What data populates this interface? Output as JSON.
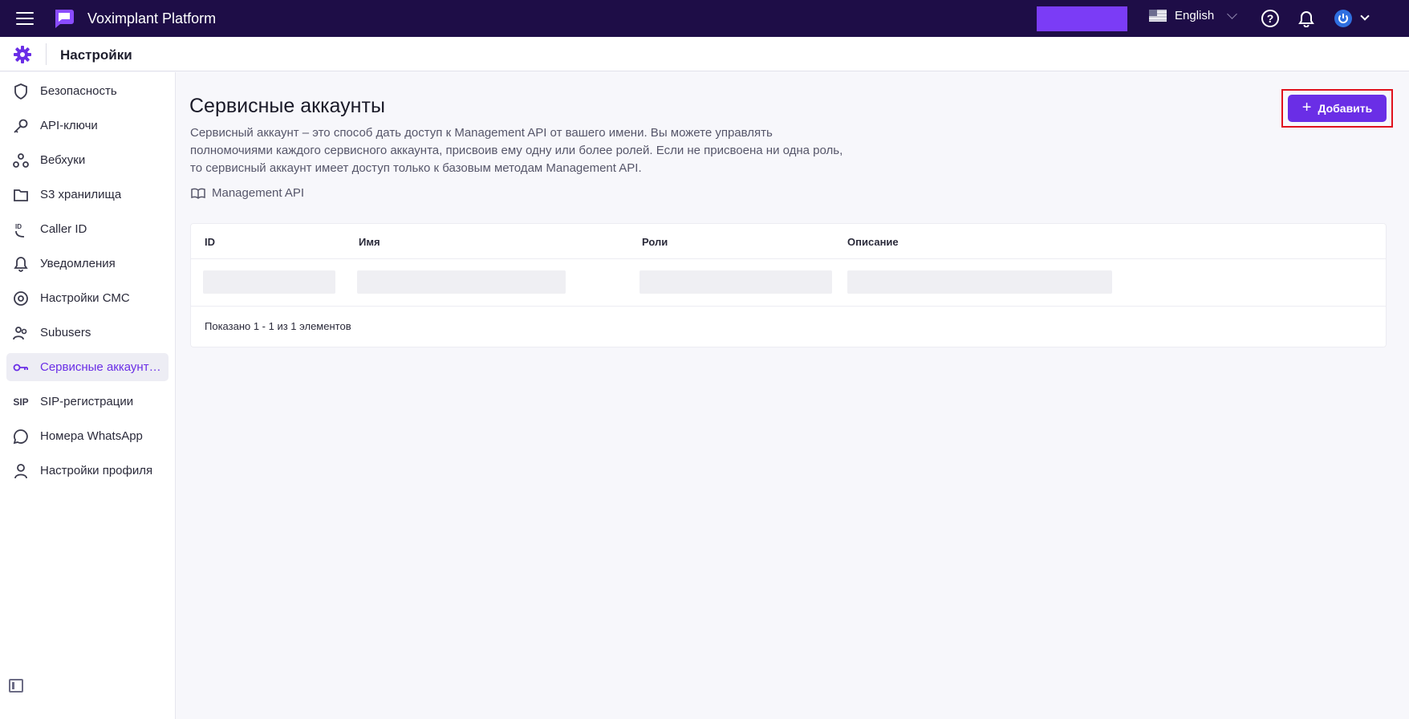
{
  "app": {
    "title": "Voximplant Platform",
    "language": "English"
  },
  "header": {
    "title": "Настройки"
  },
  "sidebar": {
    "items": [
      {
        "label": "Безопасность",
        "icon": "shield-icon"
      },
      {
        "label": "API-ключи",
        "icon": "key-icon"
      },
      {
        "label": "Вебхуки",
        "icon": "webhook-icon"
      },
      {
        "label": "S3 хранилища",
        "icon": "folder-icon"
      },
      {
        "label": "Caller ID",
        "icon": "caller-id-icon"
      },
      {
        "label": "Уведомления",
        "icon": "bell-icon"
      },
      {
        "label": "Настройки СМС",
        "icon": "sms-icon"
      },
      {
        "label": "Subusers",
        "icon": "users-icon"
      },
      {
        "label": "Сервисные аккаунт…",
        "icon": "service-key-icon",
        "active": true
      },
      {
        "label": "SIP-регистрации",
        "icon": "sip-icon",
        "icon_text": "SIP"
      },
      {
        "label": "Номера WhatsApp",
        "icon": "whatsapp-icon"
      },
      {
        "label": "Настройки профиля",
        "icon": "profile-icon"
      }
    ]
  },
  "main": {
    "title": "Сервисные аккаунты",
    "description_lines": [
      "Сервисный аккаунт – это способ дать доступ к Management API от вашего имени. Вы можете управлять",
      "полномочиями каждого сервисного аккаунта, присвоив ему одну или более ролей. Если не присвоена ни одна роль,",
      "то сервисный аккаунт имеет доступ только к базовым методам Management API."
    ],
    "doc_link": "Management API",
    "add_button": "Добавить"
  },
  "table": {
    "columns": [
      "ID",
      "Имя",
      "Роли",
      "Описание"
    ],
    "footer": "Показано 1 - 1 из 1 элементов"
  },
  "colors": {
    "topbar": "#1e0d47",
    "accent": "#6a2ee6",
    "highlight_outline": "#e0121d"
  }
}
